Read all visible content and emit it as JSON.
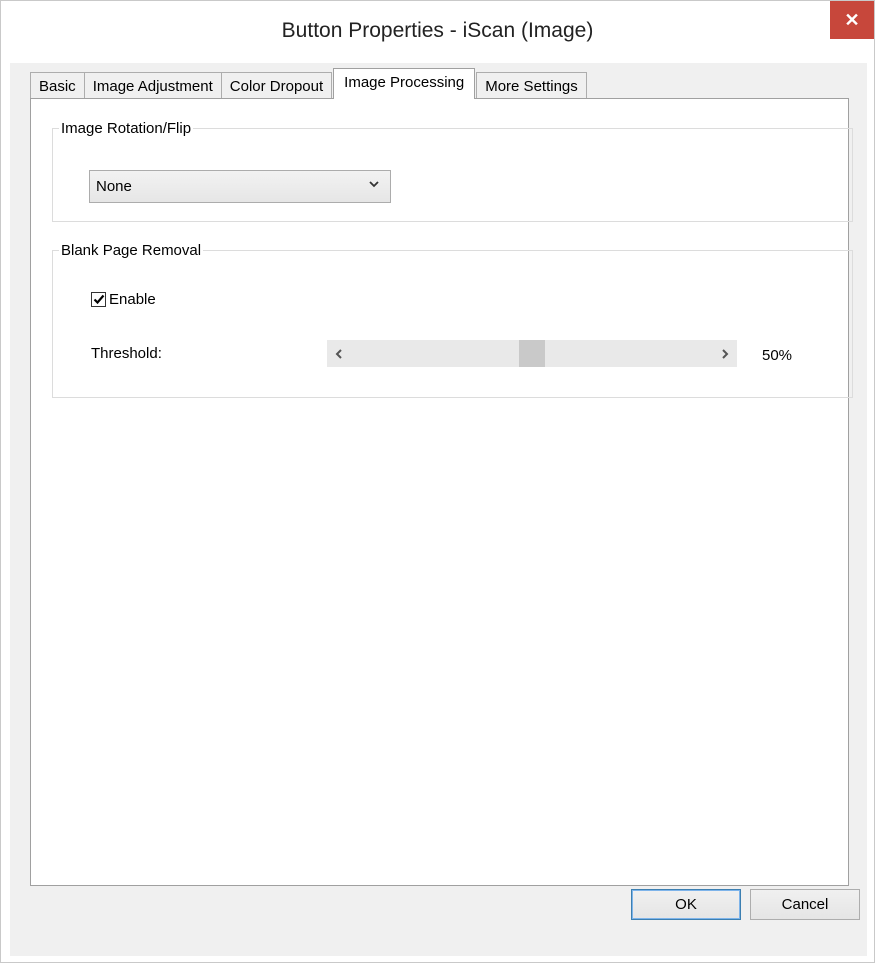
{
  "window": {
    "title": "Button Properties - iScan (Image)",
    "close_glyph": "✕",
    "accent_close": "#c7473b"
  },
  "tabs": [
    {
      "label": "Basic",
      "active": false
    },
    {
      "label": "Image Adjustment",
      "active": false
    },
    {
      "label": "Color Dropout",
      "active": false
    },
    {
      "label": "Image Processing",
      "active": true
    },
    {
      "label": "More Settings",
      "active": false
    }
  ],
  "rotation": {
    "group_label": "Image Rotation/Flip",
    "selected": "None"
  },
  "blank_page": {
    "group_label": "Blank Page Removal",
    "enable_label": "Enable",
    "enable_checked": true,
    "threshold_label": "Threshold:",
    "threshold_value": 50,
    "threshold_text": "50%"
  },
  "buttons": {
    "ok": "OK",
    "cancel": "Cancel"
  }
}
